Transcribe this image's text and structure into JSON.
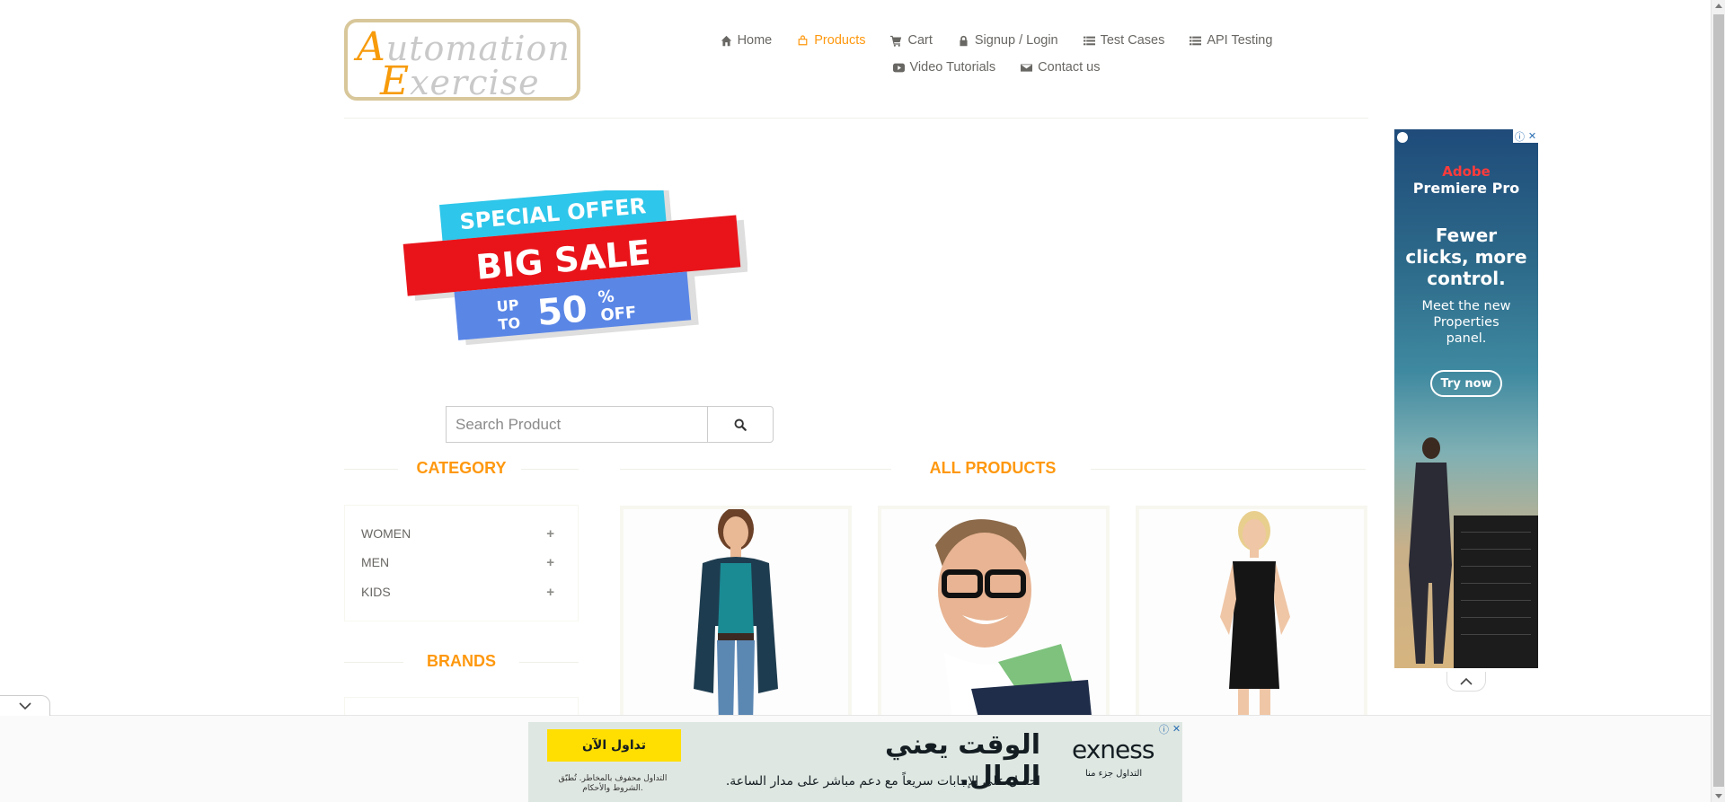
{
  "logo": {
    "line1_cap": "A",
    "line1_rest": "utomation",
    "line2_cap": "E",
    "line2_rest": "xercise"
  },
  "nav": [
    {
      "label": "Home",
      "icon": "home-icon"
    },
    {
      "label": "Products",
      "icon": "shopping-bag-icon",
      "active": true
    },
    {
      "label": "Cart",
      "icon": "cart-icon"
    },
    {
      "label": "Signup / Login",
      "icon": "lock-icon"
    },
    {
      "label": "Test Cases",
      "icon": "list-icon"
    },
    {
      "label": "API Testing",
      "icon": "list-icon"
    },
    {
      "label": "Video Tutorials",
      "icon": "youtube-icon"
    },
    {
      "label": "Contact us",
      "icon": "envelope-icon"
    }
  ],
  "banner": {
    "top": "SPECIAL OFFER",
    "middle": "BIG SALE",
    "up": "UP",
    "to": "TO",
    "percent": "50",
    "pct_sign": "%",
    "off": "OFF"
  },
  "search": {
    "placeholder": "Search Product"
  },
  "category": {
    "title": "Category",
    "items": [
      {
        "label": "WOMEN"
      },
      {
        "label": "MEN"
      },
      {
        "label": "KIDS"
      }
    ]
  },
  "brands": {
    "title": "Brands"
  },
  "products": {
    "title": "All Products"
  },
  "side_ad": {
    "brand1": "Adobe",
    "brand2": "Premiere Pro",
    "headline": "Fewer clicks, more control.",
    "sub": "Meet the new Properties panel.",
    "cta": "Try now"
  },
  "bottom_ad": {
    "cta": "تداول الآن",
    "risk": "التداول محفوف بالمخاطر. تُطبّق الشروط والأحكام.",
    "headline": "الوقت يعني المال.",
    "sub": "احصل على الإجابات سريعاً مع دعم مباشر على مدار الساعة.",
    "logo": "exness",
    "logo_sub": "التداول جزء منا"
  },
  "colors": {
    "accent": "#fe980f",
    "text": "#696763",
    "divider": "#f0f0e9"
  }
}
